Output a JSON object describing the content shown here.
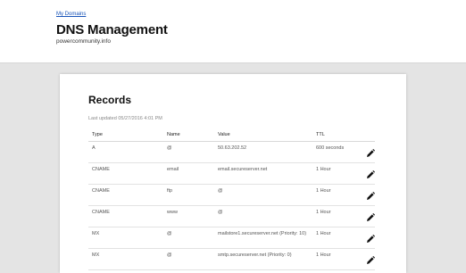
{
  "header": {
    "breadcrumb": "My Domains",
    "title": "DNS Management",
    "domain": "powercommunity.info"
  },
  "records": {
    "title": "Records",
    "last_updated": "Last updated 05/27/2016 4:01 PM",
    "columns": {
      "type": "Type",
      "name": "Name",
      "value": "Value",
      "ttl": "TTL"
    },
    "rows": [
      {
        "type": "A",
        "name": "@",
        "value": "50.63.202.52",
        "ttl": "600 seconds",
        "edit_icon": "pencil-icon"
      },
      {
        "type": "CNAME",
        "name": "email",
        "value": "email.secureserver.net",
        "ttl": "1 Hour",
        "edit_icon": "pencil-icon"
      },
      {
        "type": "CNAME",
        "name": "ftp",
        "value": "@",
        "ttl": "1 Hour",
        "edit_icon": "pencil-icon"
      },
      {
        "type": "CNAME",
        "name": "www",
        "value": "@",
        "ttl": "1 Hour",
        "edit_icon": "pencil-icon"
      },
      {
        "type": "MX",
        "name": "@",
        "value": "mailstore1.secureserver.net (Priority: 10)",
        "ttl": "1 Hour",
        "edit_icon": "pencil-icon"
      },
      {
        "type": "MX",
        "name": "@",
        "value": "smtp.secureserver.net (Priority: 0)",
        "ttl": "1 Hour",
        "edit_icon": "pencil-icon"
      }
    ]
  },
  "colors": {
    "background": "#e4e4e4",
    "card": "#ffffff",
    "link": "#1a55b8",
    "text": "#111111"
  }
}
